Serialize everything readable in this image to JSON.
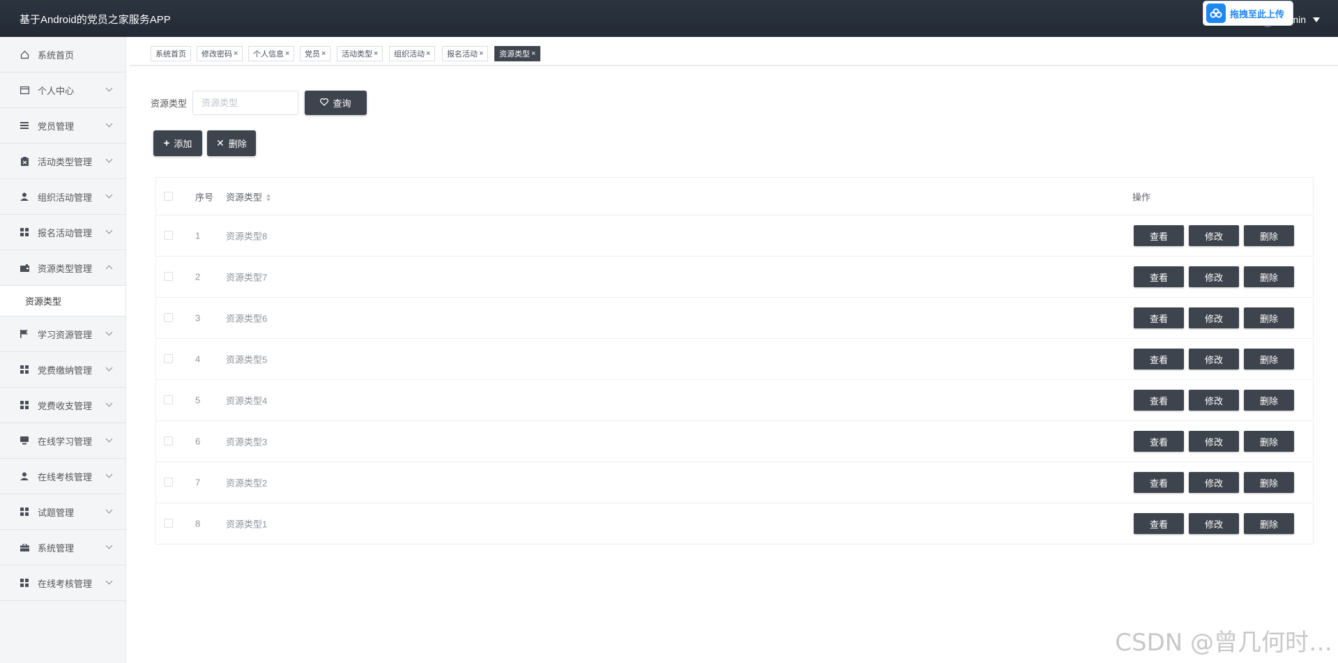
{
  "header": {
    "app_title": "基于Android的党员之家服务APP",
    "user_name": "admin",
    "upload_badge": "拖拽至此上传",
    "brand_color": "#1f87f2"
  },
  "sidebar": {
    "items": [
      {
        "label": "系统首页",
        "icon": "home-icon"
      },
      {
        "label": "个人中心",
        "icon": "id-card-icon"
      },
      {
        "label": "党员管理",
        "icon": "list-icon"
      },
      {
        "label": "活动类型管理",
        "icon": "clipboard-icon"
      },
      {
        "label": "组织活动管理",
        "icon": "user-icon"
      },
      {
        "label": "报名活动管理",
        "icon": "grid-icon"
      },
      {
        "label": "资源类型管理",
        "icon": "wallet-icon",
        "expanded": true
      },
      {
        "label": "学习资源管理",
        "icon": "flag-icon"
      },
      {
        "label": "党费缴纳管理",
        "icon": "grid-icon"
      },
      {
        "label": "党费收支管理",
        "icon": "grid-icon"
      },
      {
        "label": "在线学习管理",
        "icon": "monitor-icon"
      },
      {
        "label": "在线考核管理",
        "icon": "user-icon"
      },
      {
        "label": "试题管理",
        "icon": "grid-icon"
      },
      {
        "label": "系统管理",
        "icon": "briefcase-icon"
      },
      {
        "label": "在线考核管理",
        "icon": "grid-icon"
      }
    ],
    "submenu": {
      "label": "资源类型"
    }
  },
  "tabs": [
    {
      "label": "系统首页",
      "closable": false
    },
    {
      "label": "修改密码",
      "closable": true
    },
    {
      "label": "个人信息",
      "closable": true
    },
    {
      "label": "党员",
      "closable": true
    },
    {
      "label": "活动类型",
      "closable": true
    },
    {
      "label": "组织活动",
      "closable": true
    },
    {
      "label": "报名活动",
      "closable": true
    },
    {
      "label": "资源类型",
      "closable": true,
      "active": true
    }
  ],
  "search": {
    "label": "资源类型",
    "placeholder": "资源类型",
    "query_button": "查询"
  },
  "actions": {
    "add": "添加",
    "delete": "删除"
  },
  "table": {
    "headers": {
      "no": "序号",
      "type": "资源类型",
      "ops": "操作"
    },
    "rows": [
      {
        "no": "1",
        "type": "资源类型8"
      },
      {
        "no": "2",
        "type": "资源类型7"
      },
      {
        "no": "3",
        "type": "资源类型6"
      },
      {
        "no": "4",
        "type": "资源类型5"
      },
      {
        "no": "5",
        "type": "资源类型4"
      },
      {
        "no": "6",
        "type": "资源类型3"
      },
      {
        "no": "7",
        "type": "资源类型2"
      },
      {
        "no": "8",
        "type": "资源类型1"
      }
    ],
    "row_buttons": {
      "view": "查看",
      "edit": "修改",
      "delete": "删除"
    }
  },
  "watermark": "CSDN @曾几何时…"
}
